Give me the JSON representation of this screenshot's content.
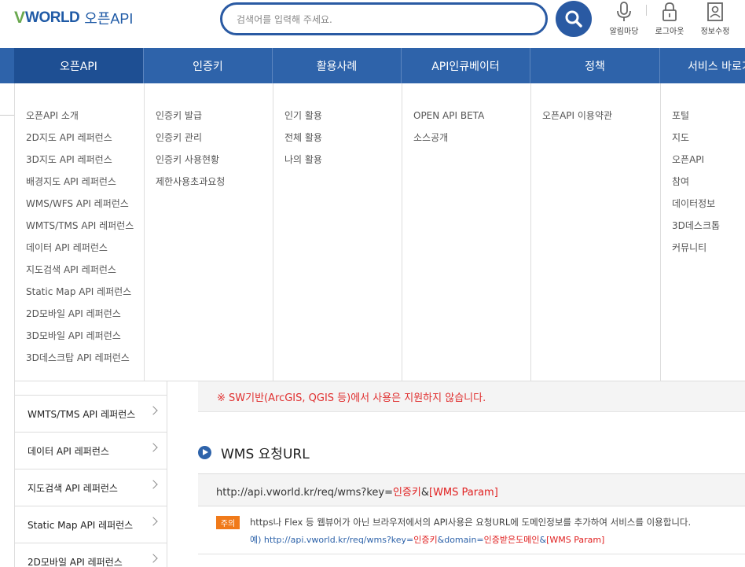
{
  "header": {
    "logo_v": "V",
    "logo_world": "WORLD",
    "logo_openapi": "오픈API",
    "search_placeholder": "검색어를 입력해 주세요.",
    "icons": [
      {
        "label": "알림마당",
        "icon": "microphone-icon"
      },
      {
        "label": "로그아웃",
        "icon": "lock-icon"
      },
      {
        "label": "정보수정",
        "icon": "user-profile-icon"
      }
    ]
  },
  "gnb": [
    "오픈API",
    "인증키",
    "활용사례",
    "API인큐베이터",
    "정책",
    "서비스 바로가기"
  ],
  "mega_menu": [
    [
      "오픈API 소개",
      "2D지도 API 레퍼런스",
      "3D지도 API 레퍼런스",
      "배경지도 API 레퍼런스",
      "WMS/WFS API 레퍼런스",
      "WMTS/TMS API 레퍼런스",
      "데이터 API 레퍼런스",
      "지도검색 API 레퍼런스",
      "Static Map API 레퍼런스",
      "2D모바일 API 레퍼런스",
      "3D모바일 API 레퍼런스",
      "3D데스크탑 API 레퍼런스"
    ],
    [
      "인증키 발급",
      "인증키 관리",
      "인증키 사용현황",
      "제한사용초과요청"
    ],
    [
      "인기 활용",
      "전체 활용",
      "나의 활용"
    ],
    [
      "OPEN API BETA",
      "소스공개"
    ],
    [
      "오픈API 이용약관"
    ],
    [
      "포털",
      "지도",
      "오픈API",
      "참여",
      "데이터정보",
      "3D데스크톱",
      "커뮤니티"
    ]
  ],
  "sidebar": [
    "WMTS/TMS API 레퍼런스",
    "데이터 API 레퍼런스",
    "지도검색 API 레퍼런스",
    "Static Map API 레퍼런스",
    "2D모바일 API 레퍼런스"
  ],
  "content": {
    "warning": "※ SW기반(ArcGIS, QGIS 등)에서 사용은 지원하지 않습니다.",
    "section_title": "WMS 요청URL",
    "url_prefix": "http://api.vworld.kr/req/wms?key=",
    "url_key": "인증키",
    "url_amp": "&",
    "url_param": "[WMS Param]",
    "note_badge": "주의",
    "note_text": "https나 Flex 등 웹뷰어가 아닌 브라우저에서의 API사용은 요청URL에 도메인정보를 추가하여 서비스를 이용합니다.",
    "note_ex_prefix": "예) http://api.vworld.kr/req/wms?key=",
    "note_ex_key": "인증키",
    "note_ex_mid": "&domain=",
    "note_ex_domain": "인증받은도메인",
    "note_ex_amp": "&",
    "note_ex_param": "[WMS Param]"
  }
}
